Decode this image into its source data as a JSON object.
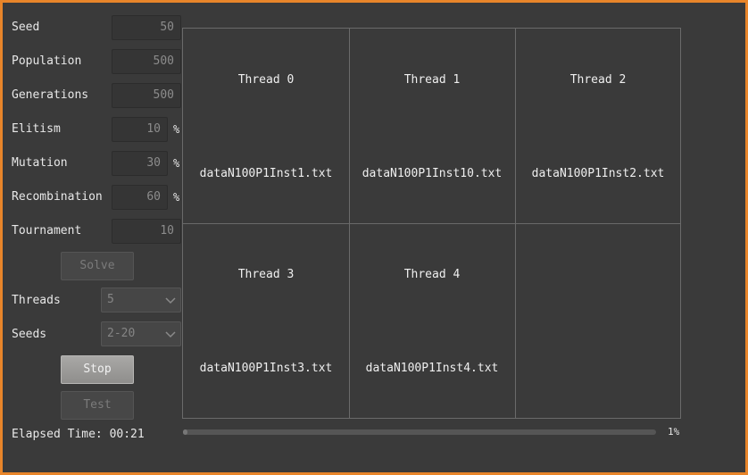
{
  "form": {
    "seed_label": "Seed",
    "seed_value": "50",
    "population_label": "Population",
    "population_value": "500",
    "generations_label": "Generations",
    "generations_value": "500",
    "elitism_label": "Elitism",
    "elitism_value": "10",
    "mutation_label": "Mutation",
    "mutation_value": "30",
    "recombination_label": "Recombination",
    "recombination_value": "60",
    "tournament_label": "Tournament",
    "tournament_value": "10",
    "percent_sign": "%",
    "solve_label": "Solve",
    "threads_label": "Threads",
    "threads_value": "5",
    "seeds_label": "Seeds",
    "seeds_value": "2-20",
    "stop_label": "Stop",
    "test_label": "Test",
    "elapsed_label": "Elapsed Time: 00:21"
  },
  "threads": [
    {
      "title": "Thread 0",
      "file": "dataN100P1Inst1.txt"
    },
    {
      "title": "Thread 1",
      "file": "dataN100P1Inst10.txt"
    },
    {
      "title": "Thread 2",
      "file": "dataN100P1Inst2.txt"
    },
    {
      "title": "Thread 3",
      "file": "dataN100P1Inst3.txt"
    },
    {
      "title": "Thread 4",
      "file": "dataN100P1Inst4.txt"
    }
  ],
  "progress": {
    "percent": 1,
    "label": "1%"
  },
  "colors": {
    "window_border": "#e8852a",
    "background": "#3a3a3a",
    "grid_line": "#6a6a6a"
  }
}
